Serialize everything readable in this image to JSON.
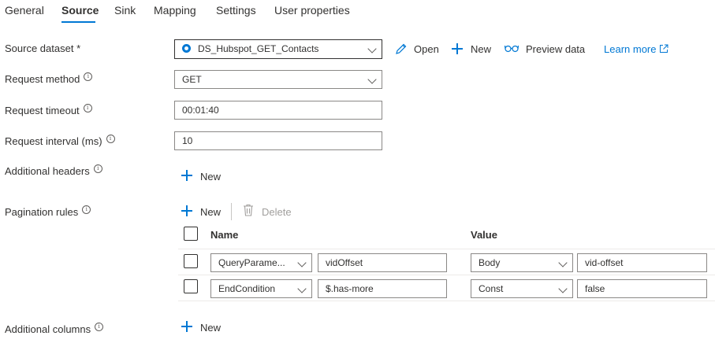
{
  "tabs": [
    "General",
    "Source",
    "Sink",
    "Mapping",
    "Settings",
    "User properties"
  ],
  "active_tab": "Source",
  "accent_color": "#0078d4",
  "form": {
    "source_dataset": {
      "label": "Source dataset",
      "required_mark": "*",
      "value": "DS_Hubspot_GET_Contacts"
    },
    "dataset_actions": {
      "open": "Open",
      "new": "New",
      "preview": "Preview data",
      "learn_more": "Learn more"
    },
    "request_method": {
      "label": "Request method",
      "value": "GET"
    },
    "request_timeout": {
      "label": "Request timeout",
      "value": "00:01:40"
    },
    "request_interval": {
      "label": "Request interval (ms)",
      "value": "10"
    },
    "additional_headers": {
      "label": "Additional headers",
      "new": "New"
    },
    "pagination": {
      "label": "Pagination rules",
      "new": "New",
      "delete": "Delete",
      "headers": {
        "name": "Name",
        "value": "Value"
      },
      "rows": [
        {
          "name_type": "QueryParame...",
          "name_value": "vidOffset",
          "value_type": "Body",
          "value_value": "vid-offset"
        },
        {
          "name_type": "EndCondition",
          "name_value": "$.has-more",
          "value_type": "Const",
          "value_value": "false"
        }
      ]
    },
    "additional_columns": {
      "label": "Additional columns",
      "new": "New"
    }
  },
  "icons": {
    "info": "i",
    "open": "pencil-icon",
    "new": "plus-icon",
    "preview": "glasses-icon",
    "learn_more": "external-link-icon",
    "delete": "trash-icon",
    "dataset": "dataset-icon",
    "dropdown": "chevron-down-icon"
  }
}
